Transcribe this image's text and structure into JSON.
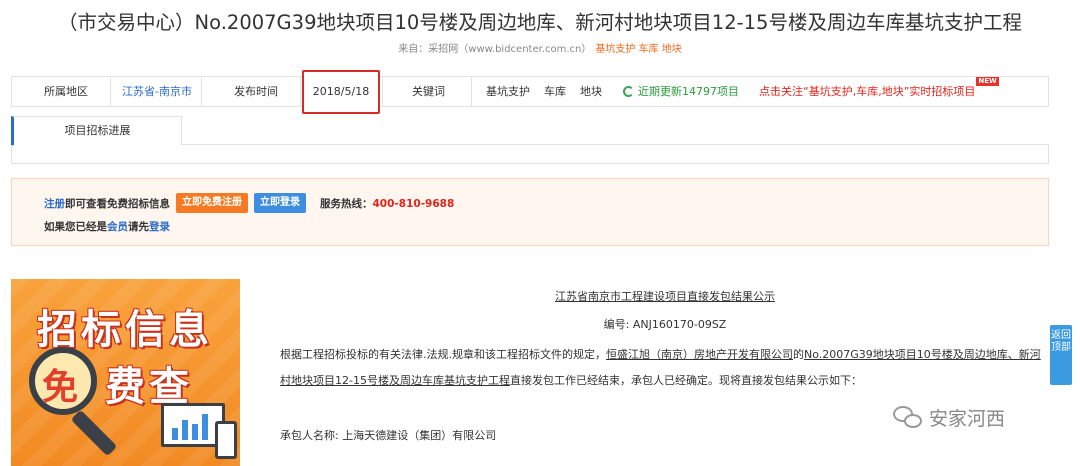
{
  "page": {
    "title": "（市交易中心）No.2007G39地块项目10号楼及周边地库、新河村地块项目12-15号楼及周边车库基坑支护工程",
    "source_prefix": "来自：采招网（www.bidcenter.com.cn）",
    "source_keywords": "基坑支护 车库 地块"
  },
  "infobar": {
    "region_label": "所属地区",
    "region_value": "江苏省-南京市",
    "date_label": "发布时间",
    "date_value": "2018/5/18",
    "keyword_label": "关键词",
    "keywords": [
      "基坑支护",
      "车库",
      "地块"
    ],
    "update_text": "近期更新14797项目",
    "follow_text": "点击关注“基坑支护,车库,地块”实时招标项目",
    "new_badge": "NEW"
  },
  "tabs": {
    "progress": "项目招标进展"
  },
  "notice": {
    "register_link": "注册",
    "row1_text": "即可查看免费招标信息",
    "register_button": "立即免费注册",
    "login_button": "立即登录",
    "hotline_label": "服务热线：",
    "hotline_number": "400-810-9688",
    "row2_prefix": "如果您已经是",
    "member_link": "会员",
    "row2_mid": "请先",
    "login_link": "登录"
  },
  "ad": {
    "line1": "招标信息",
    "lens_char": "免",
    "line2": "费查"
  },
  "article": {
    "title": "江苏省南京市工程建设项目直接发包结果公示",
    "number": "编号: ANJ160170-09SZ",
    "para_a": "根据工程招标投标的有关法律.法规.规章和该工程招标文件的规定，",
    "company": "恒盛江旭（南京）房地产开发有限公司",
    "para_b": "的",
    "project": "No.2007G39地块项目10号楼及周边地库、新河村地块项目12-15号楼及周边车库基坑支护工程",
    "para_c": "直接发包工作已经结束，承包人已经确定。现将直接发包结果公示如下：",
    "winner": "承包人名称: 上海天德建设（集团）有限公司"
  },
  "side": {
    "back_top": "返回顶部"
  },
  "watermark": {
    "text": "安家河西"
  }
}
